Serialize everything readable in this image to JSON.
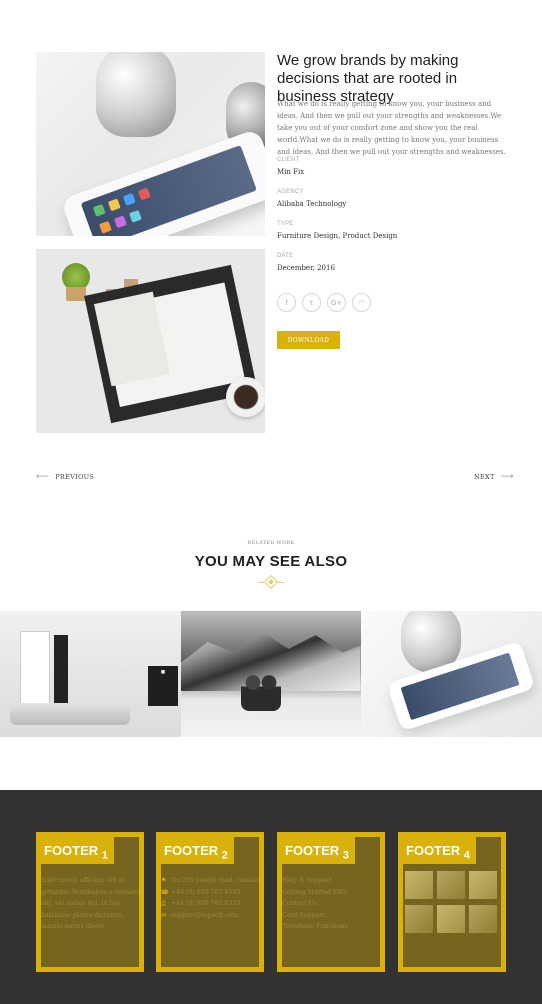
{
  "project": {
    "title": "We grow brands by making decisions that are rooted in business strategy",
    "description": "What we do is really getting to know you, your business and ideas. And then we pull out your strengths and weaknesses.We take you out of your comfort zone and show you the real world.What we do is really getting to know you, your business and ideas. And then we pull out your strengths and weaknesses.",
    "meta": [
      {
        "label": "CLIENT",
        "value": "Min Fix"
      },
      {
        "label": "AGENCY",
        "value": "Alibaba Technology"
      },
      {
        "label": "TYPE",
        "value": "Furniture Design, Product Design"
      },
      {
        "label": "DATE",
        "value": "December, 2016"
      }
    ],
    "social_icons": [
      "facebook-icon",
      "twitter-icon",
      "google-plus-icon",
      "rss-icon"
    ],
    "social_glyphs": [
      "f",
      "t",
      "G+",
      "◠"
    ],
    "download_label": "DOWNLOAD"
  },
  "pager": {
    "previous_label": "PREVIOUS",
    "next_label": "NEXT"
  },
  "related": {
    "eyebrow": "RELATED WORK",
    "title": "YOU MAY SEE ALSO"
  },
  "footer": {
    "columns": [
      {
        "title": "FOOTER",
        "number": "1",
        "lines": [
          "Sold cursus efficitur elit at",
          "gittaritis. Vestibulum a fermentum",
          "elit, vel varius dui. In hac",
          "habitasse platea dictumst,",
          "mauris metus libero."
        ]
      },
      {
        "title": "FOOTER",
        "number": "2",
        "items": [
          {
            "icon": "location-icon",
            "glyph": "⚑",
            "text": "No.200 joseph road, canada"
          },
          {
            "icon": "phone-icon",
            "glyph": "☎",
            "text": "+44 (0) 800 765 4333"
          },
          {
            "icon": "fax-icon",
            "glyph": "⎙",
            "text": "+44 (0) 800 765 4333"
          },
          {
            "icon": "mail-icon",
            "glyph": "✉",
            "text": "support@topsoft.com"
          }
        ]
      },
      {
        "title": "FOOTER",
        "number": "3",
        "lines": [
          "Help & Support",
          "Getting Started FAQ",
          "Contact Us",
          "Card Support",
          "Telephone Functions"
        ]
      },
      {
        "title": "FOOTER",
        "number": "4"
      }
    ]
  },
  "colors": {
    "accent": "#d8b20a",
    "footer_bg": "#333331"
  }
}
